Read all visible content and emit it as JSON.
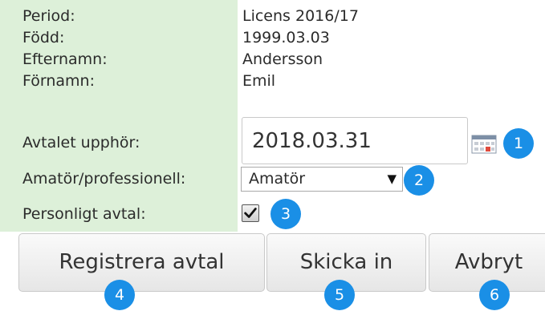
{
  "form": {
    "rows": [
      {
        "label": "Period:",
        "value": "Licens 2016/17"
      },
      {
        "label": "Född:",
        "value": "1999.03.03"
      },
      {
        "label": "Efternamn:",
        "value": "Andersson"
      },
      {
        "label": "Förnamn:",
        "value": "Emil"
      }
    ],
    "end_date": {
      "label": "Avtalet upphör:",
      "value": "2018.03.31"
    },
    "status": {
      "label": "Amatör/professionell:",
      "selected": "Amatör"
    },
    "personal": {
      "label": "Personligt avtal:",
      "checked": true
    }
  },
  "buttons": {
    "register": "Registrera avtal",
    "submit": "Skicka in",
    "cancel": "Avbryt"
  },
  "badges": [
    "1",
    "2",
    "3",
    "4",
    "5",
    "6"
  ],
  "icons": {
    "calendar": "calendar-icon",
    "dropdown": "▼"
  },
  "colors": {
    "label_background": "#ddf0d9",
    "badge": "#1a8fe6"
  }
}
